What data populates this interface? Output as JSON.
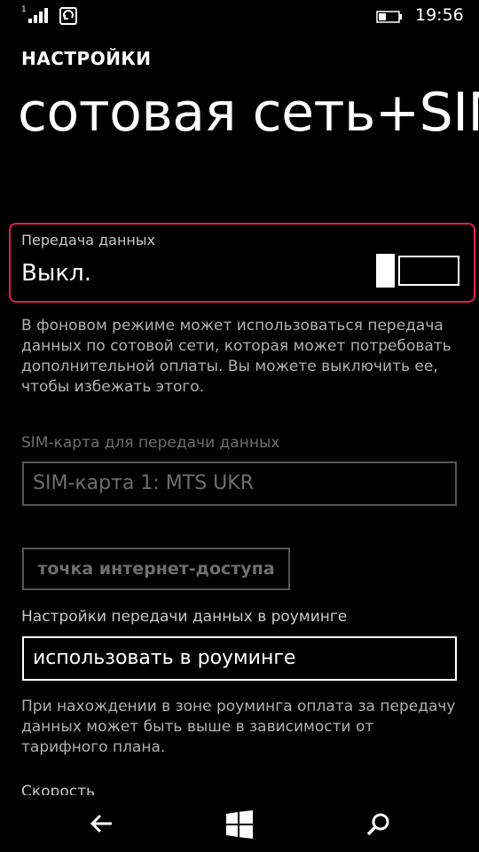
{
  "status_bar": {
    "sim_number": "1",
    "time": "19:56",
    "icons": [
      "signal-icon",
      "sync-icon",
      "battery-icon"
    ]
  },
  "header": {
    "app_title": "НАСТРОЙКИ",
    "page_title": "сотовая сеть+SIM"
  },
  "data_connection": {
    "label": "Передача данных",
    "state": "Выкл.",
    "enabled": false,
    "description": "В фоновом режиме может использоваться передача данных по сотовой сети, которая может потребовать дополнительной оплаты. Вы можете выключить ее, чтобы избежать этого."
  },
  "sim_for_data": {
    "label": "SIM-карта для передачи данных",
    "value": "SIM-карта 1: MTS UKR",
    "disabled": true
  },
  "apn_button": {
    "label": "точка интернет-доступа"
  },
  "roaming": {
    "label": "Настройки передачи данных в роуминге",
    "value": "использовать в роуминге",
    "description": "При нахождении в зоне роуминга оплата за передачу данных может быть выше в зависимости от тарифного плана."
  },
  "next_section_partial": {
    "label": "Скорость"
  },
  "nav_bar": {
    "icons": [
      "back-arrow-icon",
      "windows-start-icon",
      "search-icon"
    ]
  },
  "colors": {
    "background": "#000000",
    "accent": "#e5195f",
    "text": "#ffffff",
    "secondary_text": "#b0b0b0",
    "disabled_text": "#6e6e6e"
  }
}
